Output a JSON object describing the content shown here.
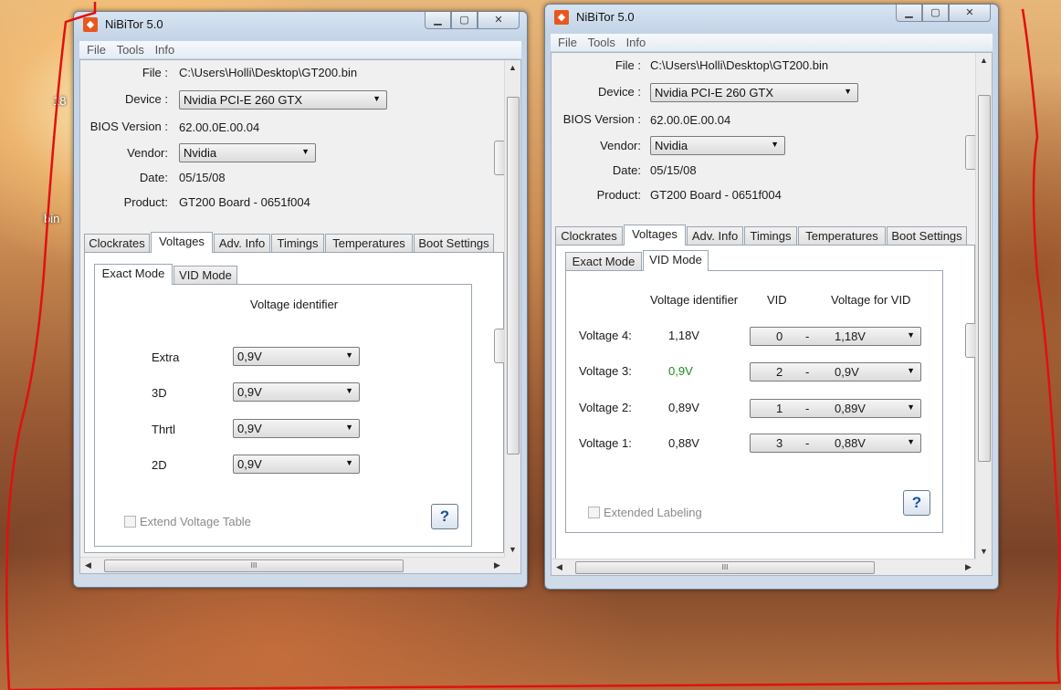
{
  "desktop": {
    "left_labels": [
      "18",
      "bin"
    ]
  },
  "left_window": {
    "title": "NiBiTor 5.0",
    "menu": [
      "File",
      "Tools",
      "Info"
    ],
    "info": {
      "file_label": "File :",
      "file_value": "C:\\Users\\Holli\\Desktop\\GT200.bin",
      "device_label": "Device :",
      "device_value": "Nvidia PCI-E 260 GTX",
      "bios_label": "BIOS Version :",
      "bios_value": "62.00.0E.00.04",
      "vendor_label": "Vendor:",
      "vendor_value": "Nvidia",
      "date_label": "Date:",
      "date_value": "05/15/08",
      "product_label": "Product:",
      "product_value": "GT200 Board - 0651f004"
    },
    "tabs": [
      "Clockrates",
      "Voltages",
      "Adv. Info",
      "Timings",
      "Temperatures",
      "Boot Settings"
    ],
    "subtabs": [
      "Exact Mode",
      "VID Mode"
    ],
    "voltage_header": "Voltage identifier",
    "rows": [
      {
        "label": "Extra",
        "value": "0,9V"
      },
      {
        "label": "3D",
        "value": "0,9V"
      },
      {
        "label": "Thrtl",
        "value": "0,9V"
      },
      {
        "label": "2D",
        "value": "0,9V"
      }
    ],
    "checkbox_label": "Extend Voltage Table",
    "help_label": "?",
    "hscroll_grip": "III"
  },
  "right_window": {
    "title": "NiBiTor 5.0",
    "menu": [
      "File",
      "Tools",
      "Info"
    ],
    "info": {
      "file_label": "File :",
      "file_value": "C:\\Users\\Holli\\Desktop\\GT200.bin",
      "device_label": "Device :",
      "device_value": "Nvidia PCI-E 260 GTX",
      "bios_label": "BIOS Version :",
      "bios_value": "62.00.0E.00.04",
      "vendor_label": "Vendor:",
      "vendor_value": "Nvidia",
      "date_label": "Date:",
      "date_value": "05/15/08",
      "product_label": "Product:",
      "product_value": "GT200 Board - 0651f004"
    },
    "tabs": [
      "Clockrates",
      "Voltages",
      "Adv. Info",
      "Timings",
      "Temperatures",
      "Boot Settings"
    ],
    "subtabs": [
      "Exact Mode",
      "VID Mode"
    ],
    "headers": {
      "voltage_identifier": "Voltage identifier",
      "vid": "VID",
      "voltage_for_vid": "Voltage for VID"
    },
    "rows": [
      {
        "label": "Voltage 4:",
        "identifier": "1,18V",
        "vid": "0",
        "dash": "-",
        "voltage": "1,18V"
      },
      {
        "label": "Voltage 3:",
        "identifier": "0,9V",
        "vid": "2",
        "dash": "-",
        "voltage": "0,9V"
      },
      {
        "label": "Voltage 2:",
        "identifier": "0,89V",
        "vid": "1",
        "dash": "-",
        "voltage": "0,89V"
      },
      {
        "label": "Voltage 1:",
        "identifier": "0,88V",
        "vid": "3",
        "dash": "-",
        "voltage": "0,88V"
      }
    ],
    "checkbox_label": "Extended Labeling",
    "help_label": "?",
    "hscroll_grip": "III"
  },
  "colors": {
    "highlight_voltage": "#1f8a1f",
    "outline": "#e01010"
  }
}
